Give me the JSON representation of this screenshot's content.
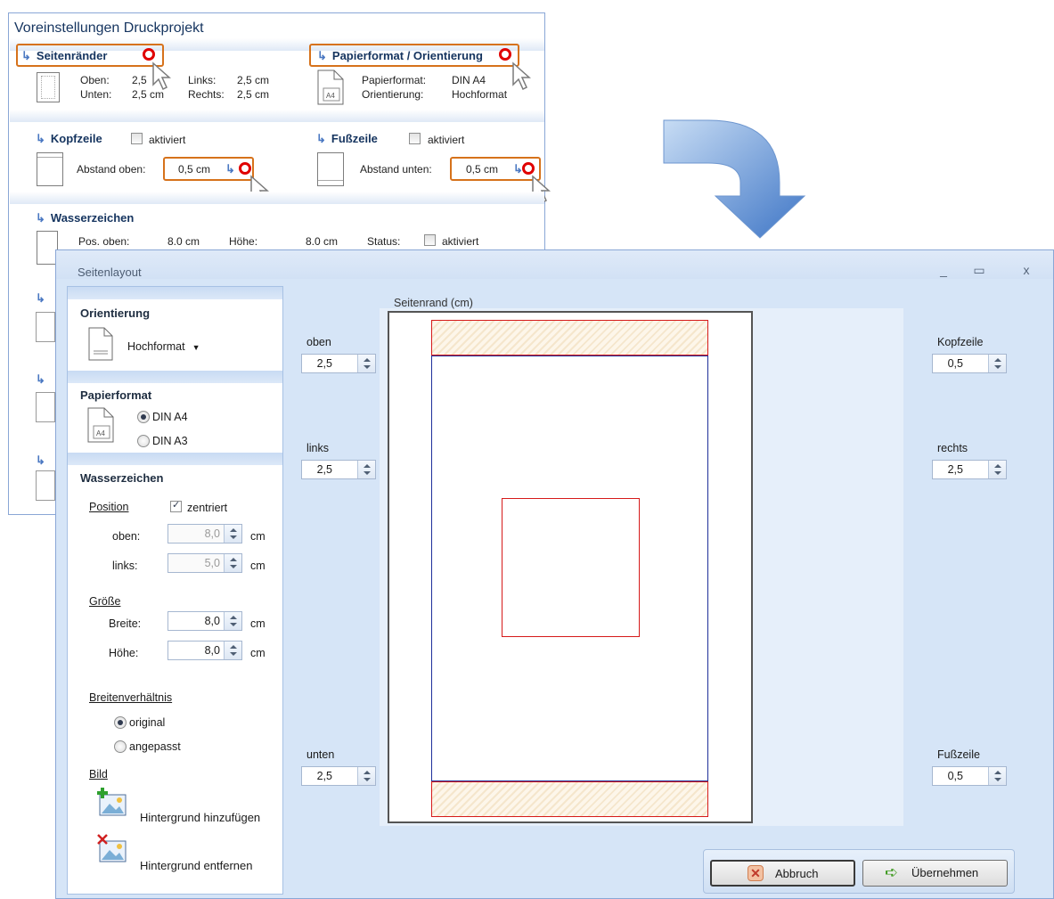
{
  "background_panel": {
    "title": "Voreinstellungen Druckprojekt",
    "margins": {
      "heading": "Seitenränder",
      "oben_label": "Oben:",
      "oben_value": "2,5",
      "unten_label": "Unten:",
      "unten_value": "2,5 cm",
      "links_label": "Links:",
      "links_value": "2,5 cm",
      "rechts_label": "Rechts:",
      "rechts_value": "2,5 cm"
    },
    "paper": {
      "heading": "Papierformat / Orientierung",
      "format_label": "Papierformat:",
      "format_value": "DIN A4",
      "orientation_label": "Orientierung:",
      "orientation_value": "Hochformat",
      "icon_text": "A4"
    },
    "header": {
      "heading": "Kopfzeile",
      "checkbox_label": "aktiviert",
      "distance_label": "Abstand oben:",
      "distance_value": "0,5 cm"
    },
    "footer": {
      "heading": "Fußzeile",
      "checkbox_label": "aktiviert",
      "distance_label": "Abstand unten:",
      "distance_value": "0,5 cm"
    },
    "watermark": {
      "heading": "Wasserzeichen",
      "pos_label": "Pos. oben:",
      "pos_value": "8.0 cm",
      "height_label": "Höhe:",
      "height_value": "8.0 cm",
      "status_label": "Status:",
      "status_checkbox": "aktiviert"
    }
  },
  "dialog": {
    "title": "Seitenlayout",
    "orientation": {
      "heading": "Orientierung",
      "value": "Hochformat"
    },
    "paper": {
      "heading": "Papierformat",
      "options": [
        "DIN A4",
        "DIN A3"
      ],
      "selected": "DIN A4",
      "icon_text": "A4"
    },
    "watermark": {
      "heading": "Wasserzeichen",
      "position_link": "Position",
      "centered_label": "zentriert",
      "centered_checked": true,
      "oben_label": "oben:",
      "oben_value": "8,0",
      "links_label": "links:",
      "links_value": "5,0",
      "unit": "cm",
      "size_link": "Größe",
      "breite_label": "Breite:",
      "breite_value": "8,0",
      "hoehe_label": "Höhe:",
      "hoehe_value": "8,0",
      "ratio_link": "Breitenverhältnis",
      "ratio_options": [
        "original",
        "angepasst"
      ],
      "ratio_selected": "original",
      "image_link": "Bild",
      "add_bg": "Hintergrund hinzufügen",
      "remove_bg": "Hintergrund entfernen"
    },
    "preview": {
      "caption": "Seitenrand (cm)",
      "oben_label": "oben",
      "oben_value": "2,5",
      "links_label": "links",
      "links_value": "2,5",
      "unten_label": "unten",
      "unten_value": "2,5",
      "kopfzeile_label": "Kopfzeile",
      "kopfzeile_value": "0,5",
      "rechts_label": "rechts",
      "rechts_value": "2,5",
      "fusszeile_label": "Fußzeile",
      "fusszeile_value": "0,5"
    },
    "buttons": {
      "cancel": "Abbruch",
      "apply": "Übernehmen"
    }
  },
  "colors": {
    "accent_orange": "#d6721b",
    "marker_red": "#e00000",
    "arrow_blue": "#5f93d6",
    "margin_blue": "#1f2f9a",
    "watermark_red": "#d61a1a"
  },
  "icons": [
    "arrow-right-icon",
    "page-icon",
    "a4-document-icon",
    "pointer-cursor-icon",
    "add-image-icon",
    "remove-image-icon",
    "cancel-x-icon",
    "apply-arrow-icon"
  ]
}
